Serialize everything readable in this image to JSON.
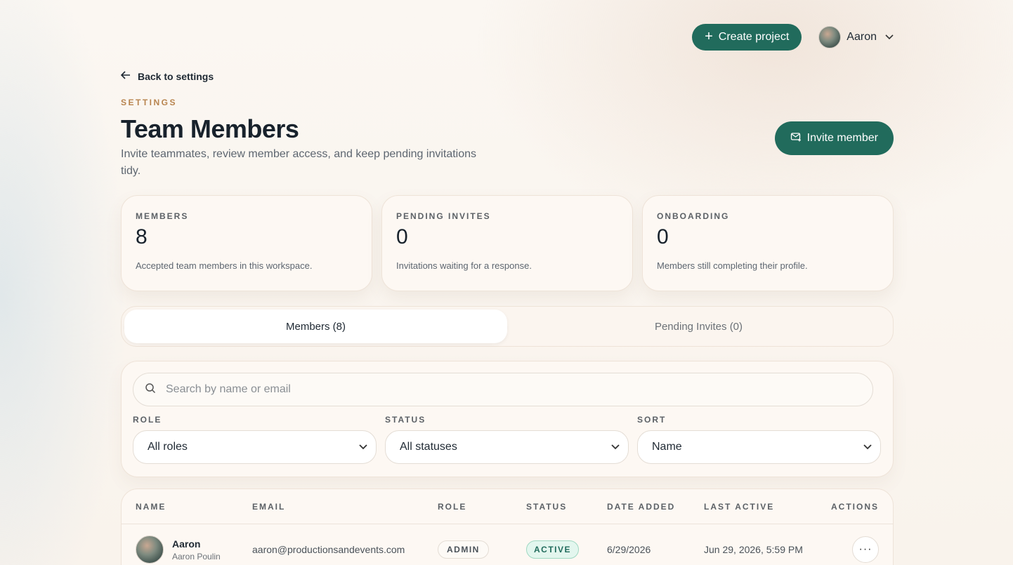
{
  "topbar": {
    "create_project_label": "Create project",
    "user_name": "Aaron"
  },
  "header": {
    "back_label": "Back to settings",
    "eyebrow": "SETTINGS",
    "title": "Team Members",
    "subtitle": "Invite teammates, review member access, and keep pending invitations tidy.",
    "invite_label": "Invite member"
  },
  "stats": [
    {
      "label": "MEMBERS",
      "value": "8",
      "desc": "Accepted team members in this workspace."
    },
    {
      "label": "PENDING INVITES",
      "value": "0",
      "desc": "Invitations waiting for a response."
    },
    {
      "label": "ONBOARDING",
      "value": "0",
      "desc": "Members still completing their profile."
    }
  ],
  "tabs": [
    {
      "label": "Members (8)",
      "active": true
    },
    {
      "label": "Pending Invites (0)",
      "active": false
    }
  ],
  "filters": {
    "search_placeholder": "Search by name or email",
    "role_label": "ROLE",
    "role_value": "All roles",
    "status_label": "STATUS",
    "status_value": "All statuses",
    "sort_label": "SORT",
    "sort_value": "Name"
  },
  "table": {
    "columns": [
      "NAME",
      "EMAIL",
      "ROLE",
      "STATUS",
      "DATE ADDED",
      "LAST ACTIVE",
      "ACTIONS"
    ],
    "rows": [
      {
        "name": "Aaron",
        "full_name": "Aaron Poulin",
        "email": "aaron@productionsandevents.com",
        "role": "ADMIN",
        "status": "ACTIVE",
        "date_added": "6/29/2026",
        "last_active": "Jun 29, 2026, 5:59 PM",
        "actions_icon": "···"
      }
    ]
  },
  "colors": {
    "accent": "#216b5c",
    "eyebrow": "#b8844f",
    "status_active_bg": "#e3f6ee"
  }
}
